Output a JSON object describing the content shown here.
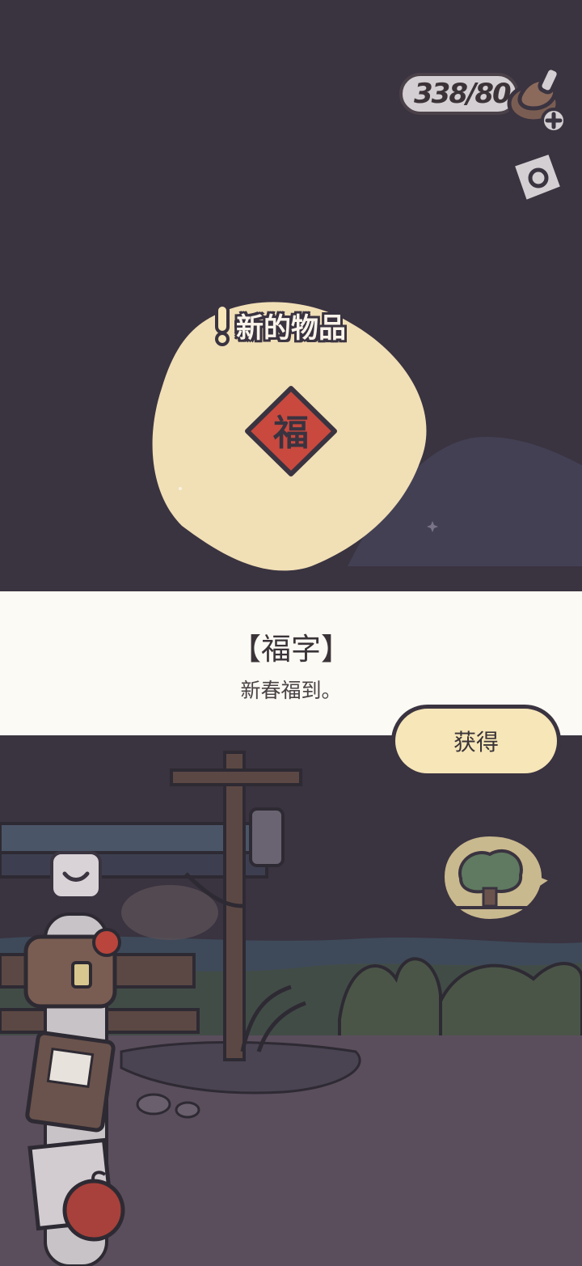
{
  "hud": {
    "clover_count": "338/80",
    "clover_icon": "clover-icon",
    "add_icon": "plus-icon",
    "paper_icon": "paper-scroll-icon"
  },
  "new_item": {
    "title": "新的物品",
    "item_icon": "fu-character-icon"
  },
  "item": {
    "name": "【福字】",
    "description": "新春福到。"
  },
  "actions": {
    "get_label": "获得"
  },
  "scene_buttons": {
    "tree_icon": "tree-icon",
    "inventory_icon": "chevron-down-icon"
  },
  "colors": {
    "background": "#3a3340",
    "blob": "#f1dfb6",
    "fu_red": "#c9493e",
    "button": "#f6e6b8"
  }
}
